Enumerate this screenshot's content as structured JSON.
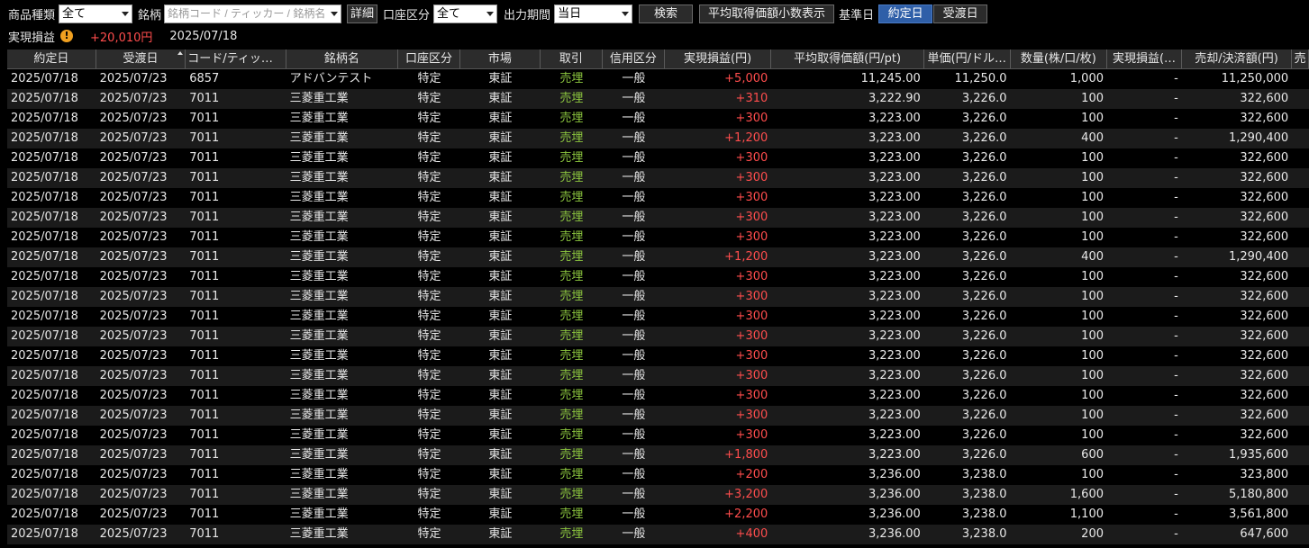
{
  "toolbar": {
    "product_type_label": "商品種類",
    "product_type_value": "全て",
    "symbol_label": "銘柄",
    "symbol_placeholder": "銘柄コード / ティッカー / 銘柄名",
    "detail_button": "詳細",
    "account_type_label": "口座区分",
    "account_type_value": "全て",
    "output_period_label": "出力期間",
    "output_period_value": "当日",
    "search_button": "検索",
    "avg_price_decimal_button": "平均取得価額小数表示",
    "base_date_label": "基準日",
    "trade_date_button": "約定日",
    "settlement_date_button": "受渡日"
  },
  "summary": {
    "label": "実現損益",
    "value": "+20,010円",
    "date": "2025/07/18"
  },
  "columns": [
    {
      "label": "約定日",
      "width": 100
    },
    {
      "label": "受渡日",
      "width": 101
    },
    {
      "label": "コード/ティッカー",
      "width": 113
    },
    {
      "label": "銘柄名",
      "width": 126
    },
    {
      "label": "口座区分",
      "width": 70
    },
    {
      "label": "市場",
      "width": 90
    },
    {
      "label": "取引",
      "width": 70
    },
    {
      "label": "信用区分",
      "width": 70
    },
    {
      "label": "実現損益(円)",
      "width": 120
    },
    {
      "label": "平均取得価額(円/pt)",
      "width": 172
    },
    {
      "label": "単価(円/ドル…",
      "width": 97
    },
    {
      "label": "数量(株/口/枚)",
      "width": 109
    },
    {
      "label": "実現損益(…",
      "width": 84
    },
    {
      "label": "売却/決済額(円)",
      "width": 124
    },
    {
      "label": "売",
      "width": 19
    }
  ],
  "rows": [
    [
      "2025/07/18",
      "2025/07/23",
      "6857",
      "アドバンテスト",
      "特定",
      "東証",
      "売埋",
      "一般",
      "+5,000",
      "11,245.00",
      "11,250.0",
      "1,000",
      "-",
      "11,250,000"
    ],
    [
      "2025/07/18",
      "2025/07/23",
      "7011",
      "三菱重工業",
      "特定",
      "東証",
      "売埋",
      "一般",
      "+310",
      "3,222.90",
      "3,226.0",
      "100",
      "-",
      "322,600"
    ],
    [
      "2025/07/18",
      "2025/07/23",
      "7011",
      "三菱重工業",
      "特定",
      "東証",
      "売埋",
      "一般",
      "+300",
      "3,223.00",
      "3,226.0",
      "100",
      "-",
      "322,600"
    ],
    [
      "2025/07/18",
      "2025/07/23",
      "7011",
      "三菱重工業",
      "特定",
      "東証",
      "売埋",
      "一般",
      "+1,200",
      "3,223.00",
      "3,226.0",
      "400",
      "-",
      "1,290,400"
    ],
    [
      "2025/07/18",
      "2025/07/23",
      "7011",
      "三菱重工業",
      "特定",
      "東証",
      "売埋",
      "一般",
      "+300",
      "3,223.00",
      "3,226.0",
      "100",
      "-",
      "322,600"
    ],
    [
      "2025/07/18",
      "2025/07/23",
      "7011",
      "三菱重工業",
      "特定",
      "東証",
      "売埋",
      "一般",
      "+300",
      "3,223.00",
      "3,226.0",
      "100",
      "-",
      "322,600"
    ],
    [
      "2025/07/18",
      "2025/07/23",
      "7011",
      "三菱重工業",
      "特定",
      "東証",
      "売埋",
      "一般",
      "+300",
      "3,223.00",
      "3,226.0",
      "100",
      "-",
      "322,600"
    ],
    [
      "2025/07/18",
      "2025/07/23",
      "7011",
      "三菱重工業",
      "特定",
      "東証",
      "売埋",
      "一般",
      "+300",
      "3,223.00",
      "3,226.0",
      "100",
      "-",
      "322,600"
    ],
    [
      "2025/07/18",
      "2025/07/23",
      "7011",
      "三菱重工業",
      "特定",
      "東証",
      "売埋",
      "一般",
      "+300",
      "3,223.00",
      "3,226.0",
      "100",
      "-",
      "322,600"
    ],
    [
      "2025/07/18",
      "2025/07/23",
      "7011",
      "三菱重工業",
      "特定",
      "東証",
      "売埋",
      "一般",
      "+1,200",
      "3,223.00",
      "3,226.0",
      "400",
      "-",
      "1,290,400"
    ],
    [
      "2025/07/18",
      "2025/07/23",
      "7011",
      "三菱重工業",
      "特定",
      "東証",
      "売埋",
      "一般",
      "+300",
      "3,223.00",
      "3,226.0",
      "100",
      "-",
      "322,600"
    ],
    [
      "2025/07/18",
      "2025/07/23",
      "7011",
      "三菱重工業",
      "特定",
      "東証",
      "売埋",
      "一般",
      "+300",
      "3,223.00",
      "3,226.0",
      "100",
      "-",
      "322,600"
    ],
    [
      "2025/07/18",
      "2025/07/23",
      "7011",
      "三菱重工業",
      "特定",
      "東証",
      "売埋",
      "一般",
      "+300",
      "3,223.00",
      "3,226.0",
      "100",
      "-",
      "322,600"
    ],
    [
      "2025/07/18",
      "2025/07/23",
      "7011",
      "三菱重工業",
      "特定",
      "東証",
      "売埋",
      "一般",
      "+300",
      "3,223.00",
      "3,226.0",
      "100",
      "-",
      "322,600"
    ],
    [
      "2025/07/18",
      "2025/07/23",
      "7011",
      "三菱重工業",
      "特定",
      "東証",
      "売埋",
      "一般",
      "+300",
      "3,223.00",
      "3,226.0",
      "100",
      "-",
      "322,600"
    ],
    [
      "2025/07/18",
      "2025/07/23",
      "7011",
      "三菱重工業",
      "特定",
      "東証",
      "売埋",
      "一般",
      "+300",
      "3,223.00",
      "3,226.0",
      "100",
      "-",
      "322,600"
    ],
    [
      "2025/07/18",
      "2025/07/23",
      "7011",
      "三菱重工業",
      "特定",
      "東証",
      "売埋",
      "一般",
      "+300",
      "3,223.00",
      "3,226.0",
      "100",
      "-",
      "322,600"
    ],
    [
      "2025/07/18",
      "2025/07/23",
      "7011",
      "三菱重工業",
      "特定",
      "東証",
      "売埋",
      "一般",
      "+300",
      "3,223.00",
      "3,226.0",
      "100",
      "-",
      "322,600"
    ],
    [
      "2025/07/18",
      "2025/07/23",
      "7011",
      "三菱重工業",
      "特定",
      "東証",
      "売埋",
      "一般",
      "+300",
      "3,223.00",
      "3,226.0",
      "100",
      "-",
      "322,600"
    ],
    [
      "2025/07/18",
      "2025/07/23",
      "7011",
      "三菱重工業",
      "特定",
      "東証",
      "売埋",
      "一般",
      "+1,800",
      "3,223.00",
      "3,226.0",
      "600",
      "-",
      "1,935,600"
    ],
    [
      "2025/07/18",
      "2025/07/23",
      "7011",
      "三菱重工業",
      "特定",
      "東証",
      "売埋",
      "一般",
      "+200",
      "3,236.00",
      "3,238.0",
      "100",
      "-",
      "323,800"
    ],
    [
      "2025/07/18",
      "2025/07/23",
      "7011",
      "三菱重工業",
      "特定",
      "東証",
      "売埋",
      "一般",
      "+3,200",
      "3,236.00",
      "3,238.0",
      "1,600",
      "-",
      "5,180,800"
    ],
    [
      "2025/07/18",
      "2025/07/23",
      "7011",
      "三菱重工業",
      "特定",
      "東証",
      "売埋",
      "一般",
      "+2,200",
      "3,236.00",
      "3,238.0",
      "1,100",
      "-",
      "3,561,800"
    ],
    [
      "2025/07/18",
      "2025/07/23",
      "7011",
      "三菱重工業",
      "特定",
      "東証",
      "売埋",
      "一般",
      "+400",
      "3,236.00",
      "3,238.0",
      "200",
      "-",
      "647,600"
    ]
  ],
  "colors": {
    "profit_red": "#ff4d4d",
    "trade_green": "#8cc63f",
    "active_button": "#2f5fa8"
  }
}
